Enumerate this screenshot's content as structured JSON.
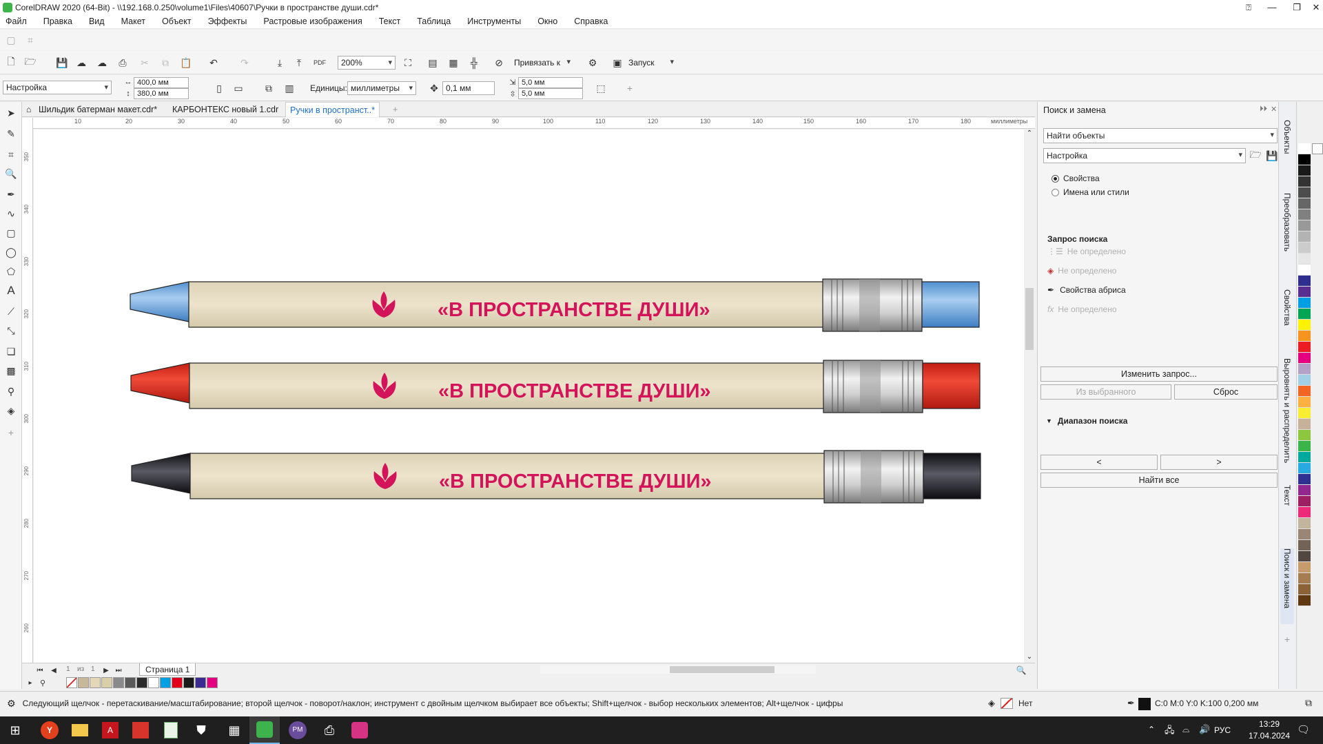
{
  "window": {
    "title": "CorelDRAW 2020 (64-Bit) - \\\\192.168.0.250\\volume1\\Files\\40607\\Ручки в пространстве души.cdr*"
  },
  "menu": [
    "Файл",
    "Правка",
    "Вид",
    "Макет",
    "Объект",
    "Эффекты",
    "Растровые изображения",
    "Текст",
    "Таблица",
    "Инструменты",
    "Окно",
    "Справка"
  ],
  "toolbar": {
    "zoom": "200%",
    "snap_label": "Привязать к",
    "launch_label": "Запуск"
  },
  "propbar": {
    "preset": "Настройка",
    "width": "400,0 мм",
    "height": "380,0 мм",
    "units_label": "Единицы:",
    "units": "миллиметры",
    "nudge": "0,1 мм",
    "dup_x": "5,0 мм",
    "dup_y": "5,0 мм"
  },
  "tabs": [
    "Шильдик батерман макет.cdr*",
    "КАРБОНТЕКС новый 1.cdr",
    "Ручки в пространст..*"
  ],
  "ruler": {
    "unit": "миллиметры",
    "top": [
      "10",
      "20",
      "30",
      "40",
      "50",
      "60",
      "70",
      "80",
      "90",
      "100",
      "110",
      "120",
      "130",
      "140",
      "150",
      "160",
      "170",
      "180"
    ],
    "left": [
      "350",
      "340",
      "330",
      "320",
      "310",
      "300",
      "290",
      "280",
      "270",
      "260"
    ]
  },
  "pens": [
    {
      "text": "«В ПРОСТРАНСТВЕ ДУШИ»",
      "tip": "#6fa3dc",
      "cap": "#5b9bd5",
      "brand": "#d4145a"
    },
    {
      "text": "«В ПРОСТРАНСТВЕ ДУШИ»",
      "tip": "#e03020",
      "cap": "#d42a1c",
      "brand": "#d4145a"
    },
    {
      "text": "«В ПРОСТРАНСТВЕ ДУШИ»",
      "tip": "#3a3a3a",
      "cap": "#1a1a22",
      "brand": "#d4145a"
    }
  ],
  "pager": {
    "current": "1",
    "of": "из",
    "total": "1",
    "page_tab": "Страница 1"
  },
  "panel": {
    "title": "Поиск и замена",
    "mode": "Найти объекты",
    "preset": "Настройка",
    "radio1": "Свойства",
    "radio2": "Имена или стили",
    "query_title": "Запрос поиска",
    "q1": "Не определено",
    "q2": "Не определено",
    "q3": "Свойства абриса",
    "q4": "Не определено",
    "edit_btn": "Изменить запрос...",
    "from_sel": "Из выбранного",
    "reset": "Сброс",
    "range": "Диапазон поиска",
    "prev": "<",
    "next": ">",
    "find_all": "Найти все"
  },
  "vtabs": [
    "Объекты",
    "Преобразовать",
    "Свойства",
    "Выровнять и распределить",
    "Текст",
    "Поиск и замена"
  ],
  "status": {
    "hint": "Следующий щелчок - перетаскивание/масштабирование; второй щелчок - поворот/наклон; инструмент с двойным щелчком выбирает все объекты; Shift+щелчок - выбор нескольких элементов; Alt+щелчок - цифры",
    "fill": "Нет",
    "outline": "C:0 M:0 Y:0 K:100  0,200 мм"
  },
  "taskbar": {
    "lang": "РУС",
    "time": "13:29",
    "date": "17.04.2024"
  },
  "palette_bottom": [
    "#ffffff",
    "#c8b89a",
    "#e3d7b8",
    "#d9cfa8",
    "#8a8a8a",
    "#5a5a5a",
    "#2b2b2b",
    "#ffffff",
    "#00a0e3",
    "#e3001b",
    "#1a1a1a",
    "#3b2a8f",
    "#e4007e"
  ],
  "palette_right": [
    "#ffffff",
    "#000000",
    "#1a1a1a",
    "#333333",
    "#4d4d4d",
    "#666666",
    "#808080",
    "#999999",
    "#b3b3b3",
    "#cccccc",
    "#e6e6e6",
    "#ffffff",
    "#2e2e8f",
    "#5a2d91",
    "#009fe3",
    "#00a651",
    "#fff200",
    "#f7941d",
    "#ed1c24",
    "#e4007e",
    "#b3a2c7",
    "#a0cfe6",
    "#f26522",
    "#fbb040",
    "#f9ed32",
    "#c7b299",
    "#8dc63f",
    "#39b54a",
    "#00a99d",
    "#27aae1",
    "#2e3192",
    "#92278f",
    "#9e1f63",
    "#ee2a7b",
    "#c2b59b",
    "#998675",
    "#736357",
    "#534741",
    "#c69c6d",
    "#a67c52",
    "#8c6239",
    "#603913"
  ]
}
